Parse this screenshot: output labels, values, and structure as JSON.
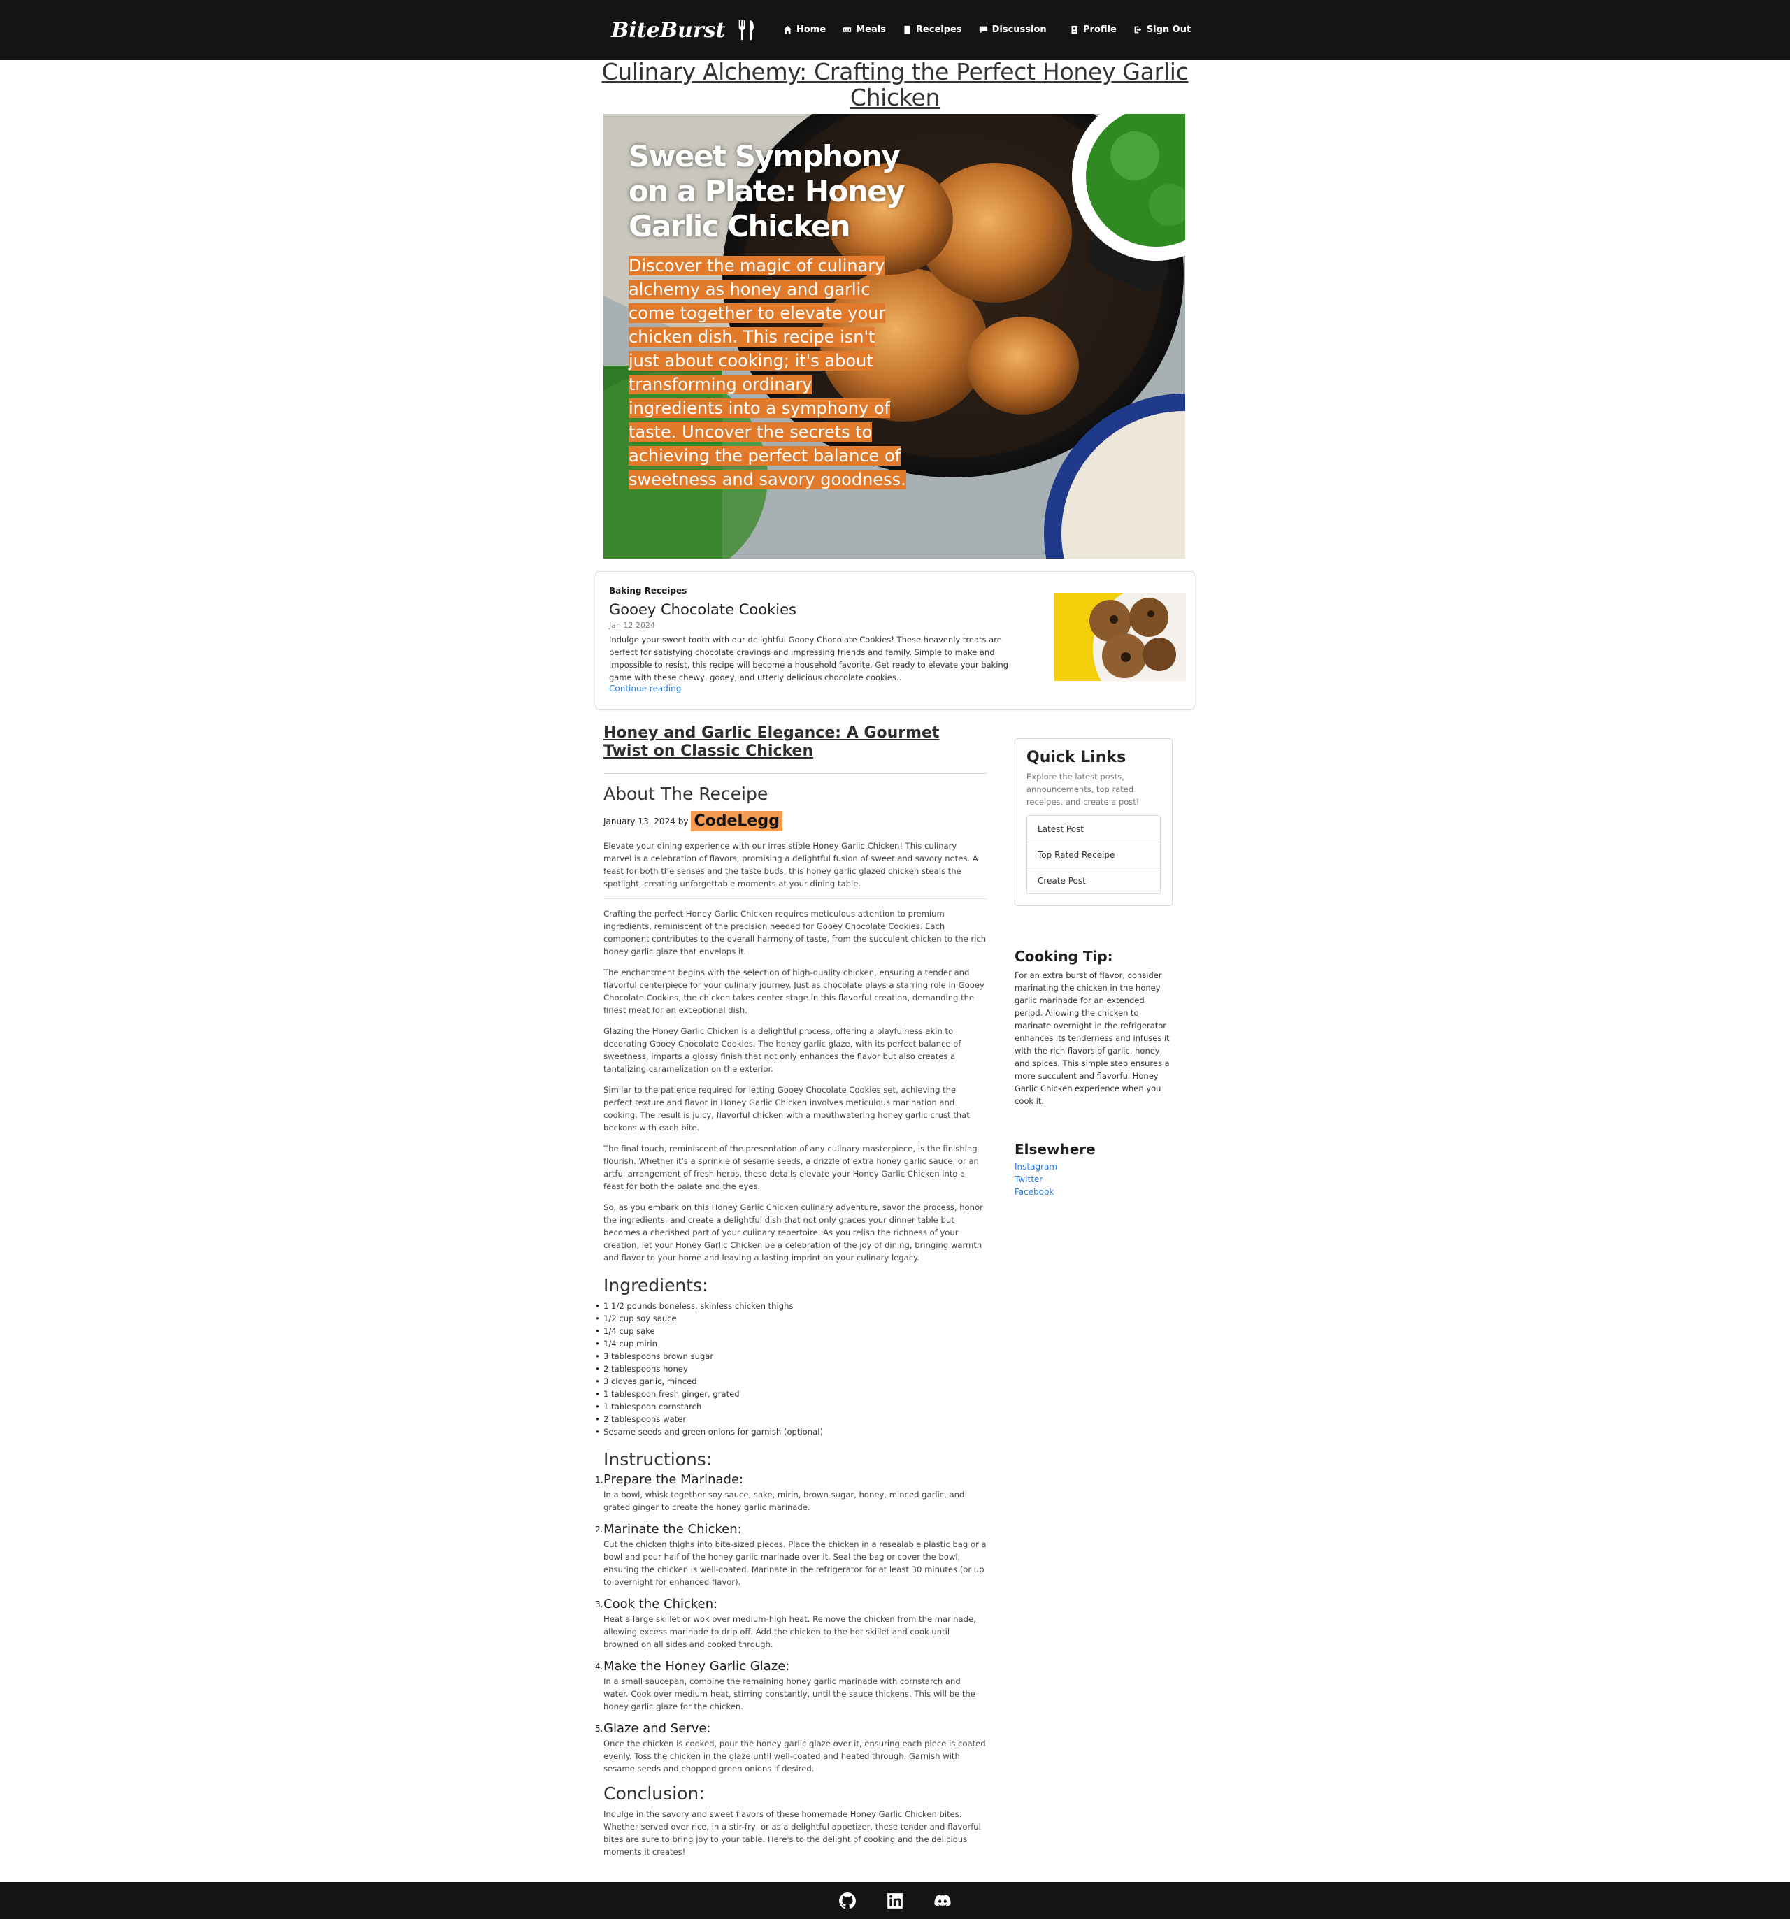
{
  "brand": {
    "name": "BiteBurst"
  },
  "nav": {
    "links": [
      {
        "label": "Home",
        "icon": "home-icon"
      },
      {
        "label": "Meals",
        "icon": "meals-icon"
      },
      {
        "label": "Receipes",
        "icon": "book-icon"
      },
      {
        "label": "Discussion",
        "icon": "chat-icon"
      }
    ],
    "right": [
      {
        "label": "Profile",
        "icon": "profile-icon"
      },
      {
        "label": "Sign Out",
        "icon": "sign-out-icon"
      }
    ]
  },
  "page": {
    "title": "Culinary Alchemy: Crafting the Perfect Honey Garlic Chicken"
  },
  "hero": {
    "heading": "Sweet Symphony on a Plate: Honey Garlic Chicken",
    "text": "Discover the magic of culinary alchemy as honey and garlic come together to elevate your chicken dish. This recipe isn't just about cooking; it's about transforming ordinary ingredients into a symphony of taste. Uncover the secrets to achieving the perfect balance of sweetness and savory goodness."
  },
  "feature": {
    "category": "Baking Receipes",
    "title": "Gooey Chocolate Cookies",
    "date": "Jan 12 2024",
    "description": "Indulge your sweet tooth with our delightful Gooey Chocolate Cookies! These heavenly treats are perfect for satisfying chocolate cravings and impressing friends and family. Simple to make and impossible to resist, this recipe will become a household favorite. Get ready to elevate your baking game with these chewy, gooey, and utterly delicious chocolate cookies..",
    "link": "Continue reading"
  },
  "article": {
    "subtitle": "Honey and Garlic Elegance: A Gourmet Twist on Classic Chicken",
    "about_heading": "About The Receipe",
    "date": "January 13, 2024",
    "by": "by",
    "author": "CodeLegg",
    "intro": "Elevate your dining experience with our irresistible Honey Garlic Chicken! This culinary marvel is a celebration of flavors, promising a delightful fusion of sweet and savory notes. A feast for both the senses and the taste buds, this honey garlic glazed chicken steals the spotlight, creating unforgettable moments at your dining table.",
    "paragraphs": [
      "Crafting the perfect Honey Garlic Chicken requires meticulous attention to premium ingredients, reminiscent of the precision needed for Gooey Chocolate Cookies. Each component contributes to the overall harmony of taste, from the succulent chicken to the rich honey garlic glaze that envelops it.",
      "The enchantment begins with the selection of high-quality chicken, ensuring a tender and flavorful centerpiece for your culinary journey. Just as chocolate plays a starring role in Gooey Chocolate Cookies, the chicken takes center stage in this flavorful creation, demanding the finest meat for an exceptional dish.",
      "Glazing the Honey Garlic Chicken is a delightful process, offering a playfulness akin to decorating Gooey Chocolate Cookies. The honey garlic glaze, with its perfect balance of sweetness, imparts a glossy finish that not only enhances the flavor but also creates a tantalizing caramelization on the exterior.",
      "Similar to the patience required for letting Gooey Chocolate Cookies set, achieving the perfect texture and flavor in Honey Garlic Chicken involves meticulous marination and cooking. The result is juicy, flavorful chicken with a mouthwatering honey garlic crust that beckons with each bite.",
      "The final touch, reminiscent of the presentation of any culinary masterpiece, is the finishing flourish. Whether it's a sprinkle of sesame seeds, a drizzle of extra honey garlic sauce, or an artful arrangement of fresh herbs, these details elevate your Honey Garlic Chicken into a feast for both the palate and the eyes.",
      "So, as you embark on this Honey Garlic Chicken culinary adventure, savor the process, honor the ingredients, and create a delightful dish that not only graces your dinner table but becomes a cherished part of your culinary repertoire. As you relish the richness of your creation, let your Honey Garlic Chicken be a celebration of the joy of dining, bringing warmth and flavor to your home and leaving a lasting imprint on your culinary legacy."
    ],
    "ingredients_heading": "Ingredients:",
    "ingredients": [
      "1 1/2 pounds boneless, skinless chicken thighs",
      "1/2 cup soy sauce",
      "1/4 cup sake",
      "1/4 cup mirin",
      "3 tablespoons brown sugar",
      "2 tablespoons honey",
      "3 cloves garlic, minced",
      "1 tablespoon fresh ginger, grated",
      "1 tablespoon cornstarch",
      "2 tablespoons water",
      "Sesame seeds and green onions for garnish (optional)"
    ],
    "instructions_heading": "Instructions:",
    "instructions": [
      {
        "num": "1.",
        "title": "Prepare the Marinade:",
        "text": "In a bowl, whisk together soy sauce, sake, mirin, brown sugar, honey, minced garlic, and grated ginger to create the honey garlic marinade."
      },
      {
        "num": "2.",
        "title": "Marinate the Chicken:",
        "text": "Cut the chicken thighs into bite-sized pieces. Place the chicken in a resealable plastic bag or a bowl and pour half of the honey garlic marinade over it. Seal the bag or cover the bowl, ensuring the chicken is well-coated. Marinate in the refrigerator for at least 30 minutes (or up to overnight for enhanced flavor)."
      },
      {
        "num": "3.",
        "title": "Cook the Chicken:",
        "text": "Heat a large skillet or wok over medium-high heat. Remove the chicken from the marinade, allowing excess marinade to drip off. Add the chicken to the hot skillet and cook until browned on all sides and cooked through."
      },
      {
        "num": "4.",
        "title": "Make the Honey Garlic Glaze:",
        "text": "In a small saucepan, combine the remaining honey garlic marinade with cornstarch and water. Cook over medium heat, stirring constantly, until the sauce thickens. This will be the honey garlic glaze for the chicken."
      },
      {
        "num": "5.",
        "title": "Glaze and Serve:",
        "text": "Once the chicken is cooked, pour the honey garlic glaze over it, ensuring each piece is coated evenly. Toss the chicken in the glaze until well-coated and heated through. Garnish with sesame seeds and chopped green onions if desired."
      }
    ],
    "conclusion_heading": "Conclusion:",
    "conclusion": "Indulge in the savory and sweet flavors of these homemade Honey Garlic Chicken bites. Whether served over rice, in a stir-fry, or as a delightful appetizer, these tender and flavorful bites are sure to bring joy to your table. Here's to the delight of cooking and the delicious moments it creates!"
  },
  "sidebar": {
    "quick_heading": "Quick Links",
    "quick_text": "Explore the latest posts, announcements, top rated receipes, and create a post!",
    "quick_links": [
      "Latest Post",
      "Top Rated Receipe",
      "Create Post"
    ],
    "tip_heading": "Cooking Tip:",
    "tip_text": "For an extra burst of flavor, consider marinating the chicken in the honey garlic marinade for an extended period. Allowing the chicken to marinate overnight in the refrigerator enhances its tenderness and infuses it with the rich flavors of garlic, honey, and spices. This simple step ensures a more succulent and flavorful Honey Garlic Chicken experience when you cook it.",
    "elsewhere_heading": "Elsewhere",
    "elsewhere_links": [
      "Instagram",
      "Twitter",
      "Facebook"
    ]
  },
  "footer": {
    "icons": [
      "github-icon",
      "linkedin-icon",
      "discord-icon"
    ]
  },
  "colors": {
    "navbar": "#141414",
    "accent": "#e27a2c",
    "author_bg": "#f39c52",
    "link": "#2b7bd8"
  }
}
